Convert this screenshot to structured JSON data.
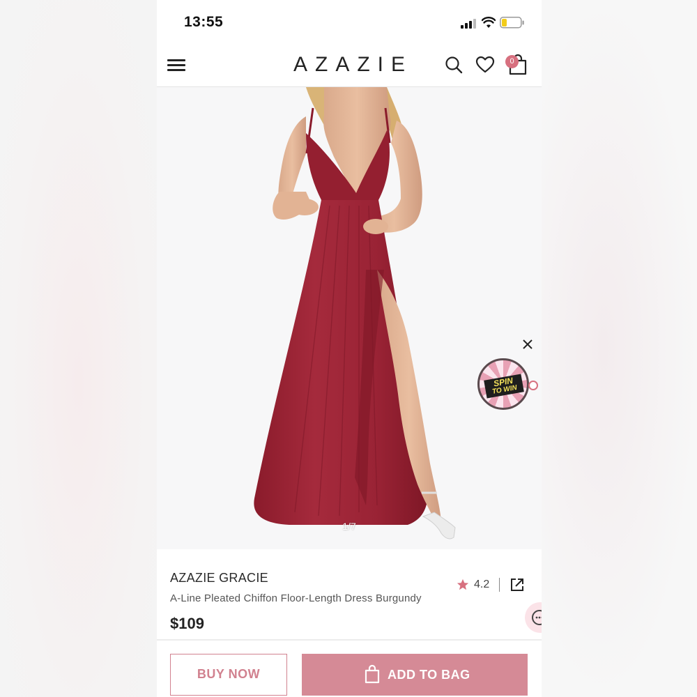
{
  "status_bar": {
    "time": "13:55"
  },
  "header": {
    "logo": "AZAZIE",
    "bag_count": "0"
  },
  "hero": {
    "pager": "1/7",
    "promo": {
      "line1": "SPIN",
      "line2": "TO WIN"
    }
  },
  "product": {
    "brand": "AZAZIE GRACIE",
    "description": "A-Line Pleated Chiffon Floor-Length Dress Burgundy",
    "price": "$109",
    "rating": "4.2"
  },
  "actions": {
    "buy_now": "BUY NOW",
    "add_to_bag": "ADD TO BAG"
  },
  "colors": {
    "accent": "#d58a96",
    "dress": "#9c2233",
    "badge": "#d7707f"
  }
}
